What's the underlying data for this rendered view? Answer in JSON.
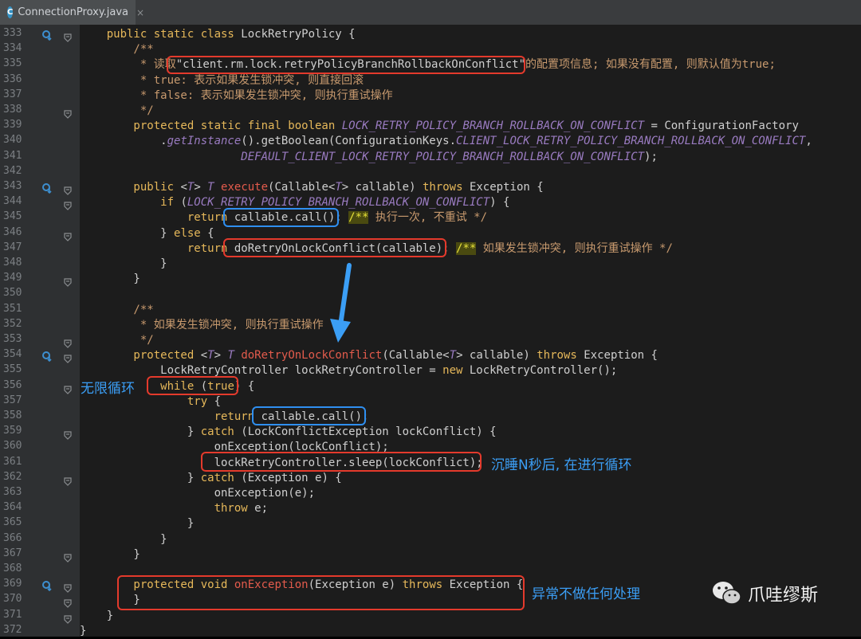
{
  "tab": {
    "title": "ConnectionProxy.java",
    "icon": "C"
  },
  "lines": [
    {
      "n": "333",
      "segs": [
        [
          "k",
          "    public static class "
        ],
        [
          "s",
          "LockRetryPolicy {"
        ]
      ]
    },
    {
      "n": "334",
      "segs": [
        [
          "cs",
          "        /**"
        ]
      ]
    },
    {
      "n": "335",
      "segs": [
        [
          "cs",
          "         * 读取"
        ],
        [
          "s",
          "\"client.rm.lock.retryPolicyBranchRollbackOnConflict\""
        ],
        [
          "cs",
          "的配置项信息; 如果没有配置, 则默认值为true;"
        ]
      ]
    },
    {
      "n": "336",
      "segs": [
        [
          "cs",
          "         * true: 表示如果发生锁冲突, 则直接回滚"
        ]
      ]
    },
    {
      "n": "337",
      "segs": [
        [
          "cs",
          "         * false: 表示如果发生锁冲突, 则执行重试操作"
        ]
      ]
    },
    {
      "n": "338",
      "segs": [
        [
          "cs",
          "         */"
        ]
      ]
    },
    {
      "n": "339",
      "segs": [
        [
          "k",
          "        protected static final boolean "
        ],
        [
          "it",
          "LOCK_RETRY_POLICY_BRANCH_ROLLBACK_ON_CONFLICT"
        ],
        [
          "s",
          " = ConfigurationFactory"
        ]
      ]
    },
    {
      "n": "340",
      "segs": [
        [
          "s",
          "            ."
        ],
        [
          "it",
          "getInstance"
        ],
        [
          "s",
          "().getBoolean(ConfigurationKeys."
        ],
        [
          "it",
          "CLIENT_LOCK_RETRY_POLICY_BRANCH_ROLLBACK_ON_CONFLICT"
        ],
        [
          "s",
          ","
        ]
      ]
    },
    {
      "n": "341",
      "segs": [
        [
          "it",
          "                        DEFAULT_CLIENT_LOCK_RETRY_POLICY_BRANCH_ROLLBACK_ON_CONFLICT"
        ],
        [
          "s",
          ");"
        ]
      ]
    },
    {
      "n": "342",
      "segs": []
    },
    {
      "n": "343",
      "segs": [
        [
          "k",
          "        public "
        ],
        [
          "s",
          "<"
        ],
        [
          "it",
          "T"
        ],
        [
          "s",
          "> "
        ],
        [
          "it",
          "T "
        ],
        [
          "m",
          "execute"
        ],
        [
          "s",
          "(Callable<"
        ],
        [
          "it",
          "T"
        ],
        [
          "s",
          "> callable) "
        ],
        [
          "k",
          "throws "
        ],
        [
          "s",
          "Exception {"
        ]
      ]
    },
    {
      "n": "344",
      "segs": [
        [
          "k",
          "            if "
        ],
        [
          "s",
          "("
        ],
        [
          "it",
          "LOCK_RETRY_POLICY_BRANCH_ROLLBACK_ON_CONFLICT"
        ],
        [
          "s",
          ") {"
        ]
      ]
    },
    {
      "n": "345",
      "segs": [
        [
          "k",
          "                return "
        ],
        [
          "s",
          "callable.call(); "
        ],
        [
          "todo",
          "/**"
        ],
        [
          "cs",
          " 执行一次, 不重试 */"
        ]
      ]
    },
    {
      "n": "346",
      "segs": [
        [
          "s",
          "            } "
        ],
        [
          "k",
          "else "
        ],
        [
          "s",
          "{"
        ]
      ]
    },
    {
      "n": "347",
      "segs": [
        [
          "k",
          "                return "
        ],
        [
          "s",
          "doRetryOnLockConflict(callable); "
        ],
        [
          "todo",
          "/**"
        ],
        [
          "cs",
          " 如果发生锁冲突, 则执行重试操作 */"
        ]
      ]
    },
    {
      "n": "348",
      "segs": [
        [
          "s",
          "            }"
        ]
      ]
    },
    {
      "n": "349",
      "segs": [
        [
          "s",
          "        }"
        ]
      ]
    },
    {
      "n": "350",
      "segs": []
    },
    {
      "n": "351",
      "segs": [
        [
          "cs",
          "        /**"
        ]
      ]
    },
    {
      "n": "352",
      "segs": [
        [
          "cs",
          "         * 如果发生锁冲突, 则执行重试操作"
        ]
      ]
    },
    {
      "n": "353",
      "segs": [
        [
          "cs",
          "         */"
        ]
      ]
    },
    {
      "n": "354",
      "segs": [
        [
          "k",
          "        protected "
        ],
        [
          "s",
          "<"
        ],
        [
          "it",
          "T"
        ],
        [
          "s",
          "> "
        ],
        [
          "it",
          "T "
        ],
        [
          "m",
          "doRetryOnLockConflict"
        ],
        [
          "s",
          "(Callable<"
        ],
        [
          "it",
          "T"
        ],
        [
          "s",
          "> callable) "
        ],
        [
          "k",
          "throws "
        ],
        [
          "s",
          "Exception {"
        ]
      ]
    },
    {
      "n": "355",
      "segs": [
        [
          "s",
          "            LockRetryController lockRetryController = "
        ],
        [
          "k",
          "new "
        ],
        [
          "s",
          "LockRetryController();"
        ]
      ]
    },
    {
      "n": "356",
      "segs": [
        [
          "k",
          "            while "
        ],
        [
          "s",
          "("
        ],
        [
          "k",
          "true"
        ],
        [
          "s",
          ") {"
        ]
      ]
    },
    {
      "n": "357",
      "segs": [
        [
          "k",
          "                try "
        ],
        [
          "s",
          "{"
        ]
      ]
    },
    {
      "n": "358",
      "segs": [
        [
          "k",
          "                    return "
        ],
        [
          "s",
          "callable.call();"
        ]
      ]
    },
    {
      "n": "359",
      "segs": [
        [
          "s",
          "                } "
        ],
        [
          "k",
          "catch "
        ],
        [
          "s",
          "(LockConflictException lockConflict) {"
        ]
      ]
    },
    {
      "n": "360",
      "segs": [
        [
          "s",
          "                    onException(lockConflict);"
        ]
      ]
    },
    {
      "n": "361",
      "segs": [
        [
          "s",
          "                    lockRetryController.sleep(lockConflict);"
        ]
      ]
    },
    {
      "n": "362",
      "segs": [
        [
          "s",
          "                } "
        ],
        [
          "k",
          "catch "
        ],
        [
          "s",
          "(Exception e) {"
        ]
      ]
    },
    {
      "n": "363",
      "segs": [
        [
          "s",
          "                    onException(e);"
        ]
      ]
    },
    {
      "n": "364",
      "segs": [
        [
          "k",
          "                    throw "
        ],
        [
          "s",
          "e;"
        ]
      ]
    },
    {
      "n": "365",
      "segs": [
        [
          "s",
          "                }"
        ]
      ]
    },
    {
      "n": "366",
      "segs": [
        [
          "s",
          "            }"
        ]
      ]
    },
    {
      "n": "367",
      "segs": [
        [
          "s",
          "        }"
        ]
      ]
    },
    {
      "n": "368",
      "segs": []
    },
    {
      "n": "369",
      "segs": [
        [
          "k",
          "        protected void "
        ],
        [
          "m",
          "onException"
        ],
        [
          "s",
          "(Exception e) "
        ],
        [
          "k",
          "throws "
        ],
        [
          "s",
          "Exception {"
        ]
      ]
    },
    {
      "n": "370",
      "segs": [
        [
          "s",
          "        }"
        ]
      ]
    },
    {
      "n": "371",
      "segs": [
        [
          "s",
          "    }"
        ]
      ]
    },
    {
      "n": "372",
      "segs": [
        [
          "s",
          "}"
        ]
      ]
    }
  ],
  "annotations": {
    "infinite_loop": "无限循环",
    "sleep_note": "沉睡N秒后, 在进行循环",
    "exception_note": "异常不做任何处理",
    "watermark": "爪哇缪斯"
  },
  "colors": {
    "red_box": "#e43a2c",
    "blue_box": "#2f8ff0",
    "arrow": "#3b9ef5"
  }
}
